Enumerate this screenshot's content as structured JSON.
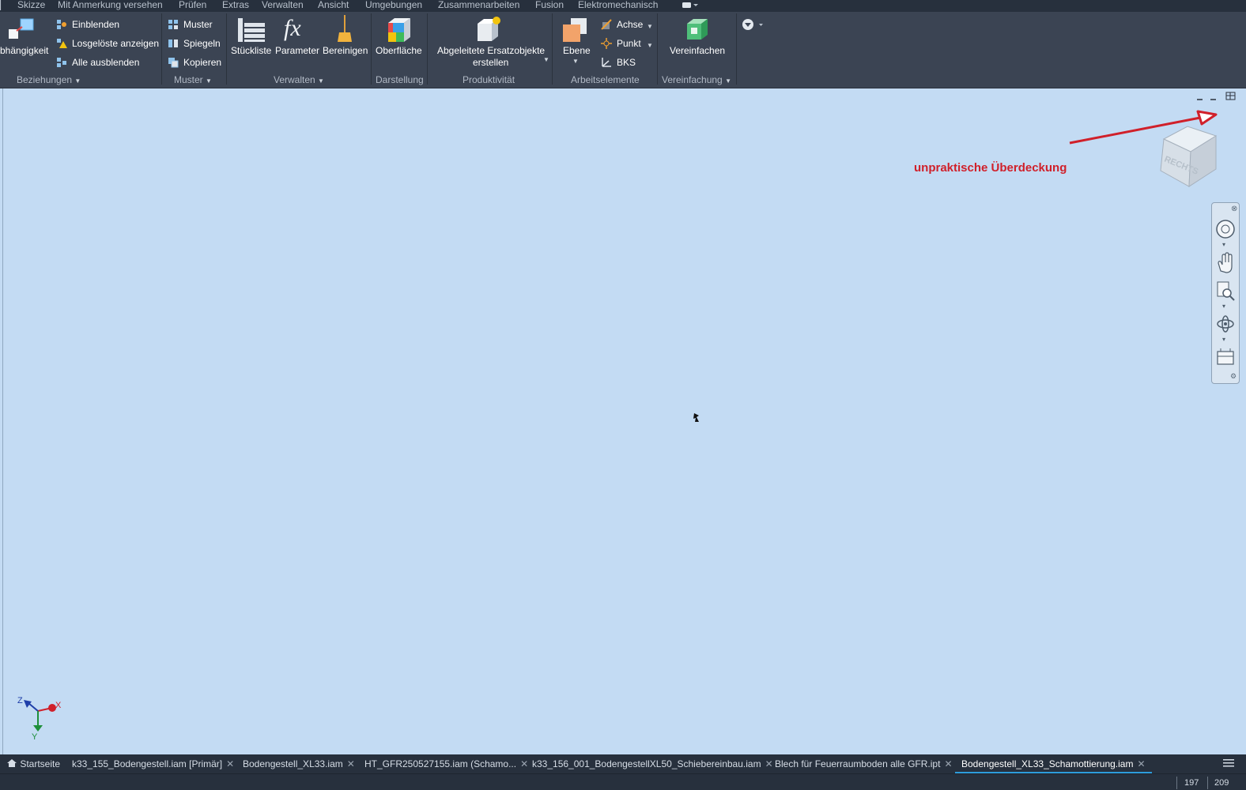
{
  "menu": [
    "Skizze",
    "Mit Anmerkung versehen",
    "Prüfen",
    "Extras",
    "Verwalten",
    "Ansicht",
    "Umgebungen",
    "Zusammenarbeiten",
    "Fusion",
    "Elektromechanisch"
  ],
  "ribbon": {
    "beziehungen": {
      "big_label": "bhängigkeit",
      "einblenden": "Einblenden",
      "losgeloeste": "Losgelöste anzeigen",
      "alle_ausblenden": "Alle ausblenden",
      "group": "Beziehungen"
    },
    "muster": {
      "muster": "Muster",
      "spiegeln": "Spiegeln",
      "kopieren": "Kopieren",
      "group": "Muster"
    },
    "verwalten": {
      "stueckliste": "Stückliste",
      "parameter": "Parameter",
      "bereinigen": "Bereinigen",
      "group": "Verwalten"
    },
    "darstellung": {
      "oberflaeche": "Oberfläche",
      "group": "Darstellung"
    },
    "produktivitaet": {
      "line1": "Abgeleitete Ersatzobjekte",
      "line2": "erstellen",
      "group": "Produktivität"
    },
    "arbeitselemente": {
      "ebene": "Ebene",
      "achse": "Achse",
      "punkt": "Punkt",
      "bks": "BKS",
      "group": "Arbeitselemente"
    },
    "vereinfachung": {
      "vereinfachen": "Vereinfachen",
      "group": "Vereinfachung"
    }
  },
  "viewport": {
    "annotation": "unpraktische Überdeckung",
    "viewcube_face": "RECHTS",
    "triad": {
      "x": "X",
      "y": "Y",
      "z": "Z"
    }
  },
  "tabs": [
    {
      "label": "Startseite",
      "icon": "home-icon",
      "closable": false,
      "active": false
    },
    {
      "label": "k33_155_Bodengestell.iam [Primär]",
      "closable": true,
      "active": false
    },
    {
      "label": "Bodengestell_XL33.iam",
      "closable": true,
      "active": false
    },
    {
      "label": "HT_GFR250527155.iam (Schamo...",
      "closable": true,
      "active": false
    },
    {
      "label": "k33_156_001_BodengestellXL50_Schiebereinbau.iam",
      "closable": true,
      "active": false
    },
    {
      "label": "Blech für Feuerraumboden alle GFR.ipt",
      "closable": true,
      "active": false
    },
    {
      "label": "Bodengestell_XL33_Schamottierung.iam",
      "closable": true,
      "active": true
    }
  ],
  "tab_close_glyph": "✕",
  "status": {
    "n1": "197",
    "n2": "209"
  },
  "colors": {
    "accent": "#2d9cdb",
    "viewport": "#c3dbf3",
    "ribbon": "#3b4453",
    "annotation": "#d0202a"
  }
}
